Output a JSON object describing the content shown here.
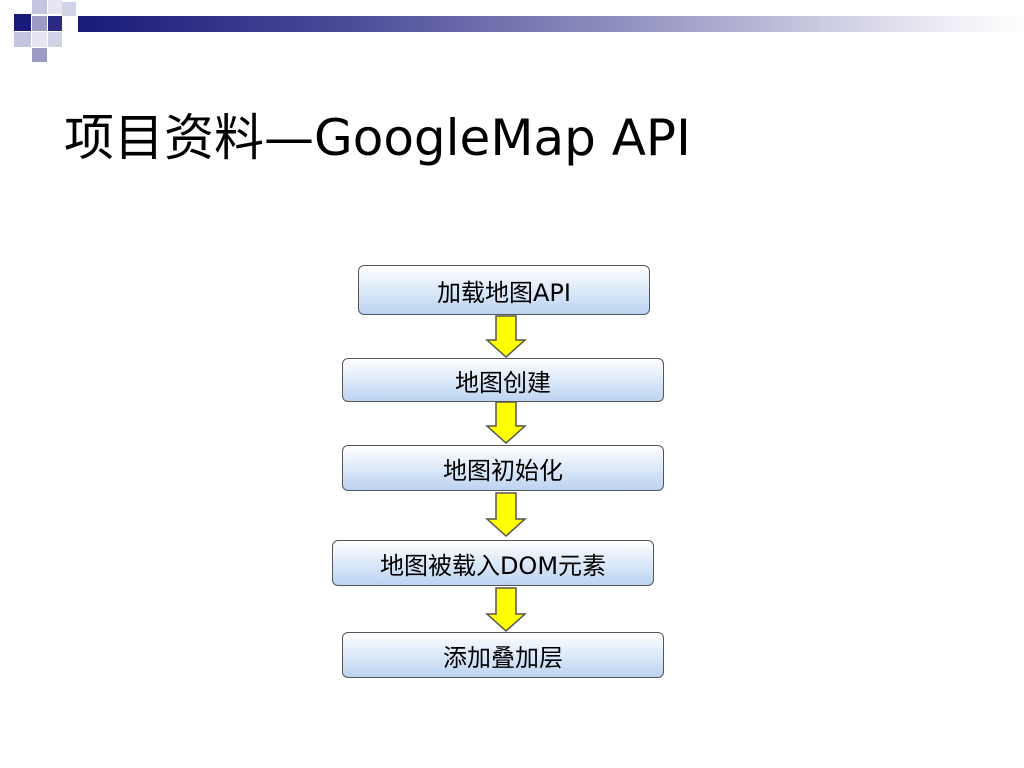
{
  "slide": {
    "title": "项目资料—GoogleMap API"
  },
  "flowchart": {
    "steps": [
      {
        "label": "加载地图API"
      },
      {
        "label": "地图创建"
      },
      {
        "label": "地图初始化"
      },
      {
        "label": "地图被载入DOM元素"
      },
      {
        "label": "添加叠加层"
      }
    ]
  },
  "colors": {
    "arrow_fill": "#ffff00",
    "arrow_stroke": "#555555",
    "box_gradient_top": "#ffffff",
    "box_gradient_bottom": "#bcd3f1",
    "decor_navy": "#1a1a7a",
    "decor_lavender": "#9b9bc6"
  }
}
